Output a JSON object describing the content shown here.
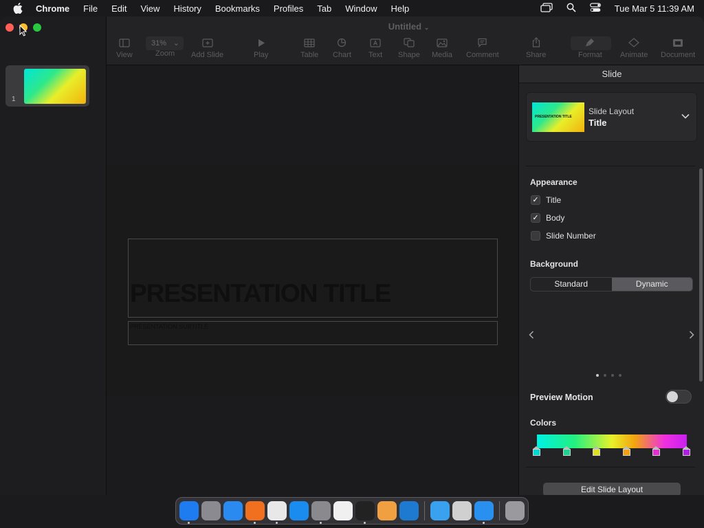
{
  "menubar": {
    "app_name": "Chrome",
    "items": [
      "File",
      "Edit",
      "View",
      "History",
      "Bookmarks",
      "Profiles",
      "Tab",
      "Window",
      "Help"
    ],
    "clock": "Tue Mar 5  11:39 AM"
  },
  "window": {
    "doc_title": "Untitled",
    "zoom_value": "31%",
    "toolbar": {
      "view": "View",
      "zoom": "Zoom",
      "add_slide": "Add Slide",
      "play": "Play",
      "table": "Table",
      "chart": "Chart",
      "text": "Text",
      "shape": "Shape",
      "media": "Media",
      "comment": "Comment",
      "share": "Share",
      "format": "Format",
      "animate": "Animate",
      "document": "Document"
    }
  },
  "navigator": {
    "slide_number": "1"
  },
  "slide": {
    "title": "PRESENTATION TITLE",
    "subtitle": "PRESENTATION SUBTITLE"
  },
  "inspector": {
    "header": "Slide",
    "layout_label": "Slide Layout",
    "layout_name": "Title",
    "layout_thumb_text": "PRESENTATION TITLE",
    "appearance_heading": "Appearance",
    "appearance": {
      "title": {
        "label": "Title",
        "checked": true
      },
      "body": {
        "label": "Body",
        "checked": true
      },
      "slide_number": {
        "label": "Slide Number",
        "checked": false
      }
    },
    "background_heading": "Background",
    "background_options": {
      "standard": "Standard",
      "dynamic": "Dynamic"
    },
    "background_selected": "Dynamic",
    "preview_motion_label": "Preview Motion",
    "preview_motion_on": false,
    "colors_heading": "Colors",
    "color_stops": [
      "#00d8d0",
      "#20d090",
      "#e0e020",
      "#f0a010",
      "#e030d0",
      "#b020e0"
    ],
    "edit_button": "Edit Slide Layout"
  },
  "dock": {
    "apps": [
      {
        "icon": "finder-icon",
        "color": "#1e7cf0",
        "running": true
      },
      {
        "icon": "launchpad-icon",
        "color": "#8a8a90",
        "running": false
      },
      {
        "icon": "safari-icon",
        "color": "#2a8af0",
        "running": false
      },
      {
        "icon": "firefox-icon",
        "color": "#f07020",
        "running": true
      },
      {
        "icon": "chrome-icon",
        "color": "#e8e8e8",
        "running": true
      },
      {
        "icon": "app-store-icon",
        "color": "#1a8cf0",
        "running": false
      },
      {
        "icon": "system-settings-icon",
        "color": "#8a8a8e",
        "running": true
      },
      {
        "icon": "textedit-icon",
        "color": "#f0f0f0",
        "running": false
      },
      {
        "icon": "terminal-icon",
        "color": "#222",
        "running": true
      },
      {
        "icon": "garageband-icon",
        "color": "#f0a040",
        "running": false
      },
      {
        "icon": "vscode-icon",
        "color": "#1e7ad0",
        "running": false
      },
      {
        "icon": "cloud-folder-icon",
        "color": "#3aa0f0",
        "running": false
      },
      {
        "icon": "preview-icon",
        "color": "#d0d0d0",
        "running": false
      },
      {
        "icon": "keynote-icon",
        "color": "#2a90f0",
        "running": true
      },
      {
        "icon": "trash-icon",
        "color": "#9a9a9e",
        "running": false
      }
    ]
  }
}
